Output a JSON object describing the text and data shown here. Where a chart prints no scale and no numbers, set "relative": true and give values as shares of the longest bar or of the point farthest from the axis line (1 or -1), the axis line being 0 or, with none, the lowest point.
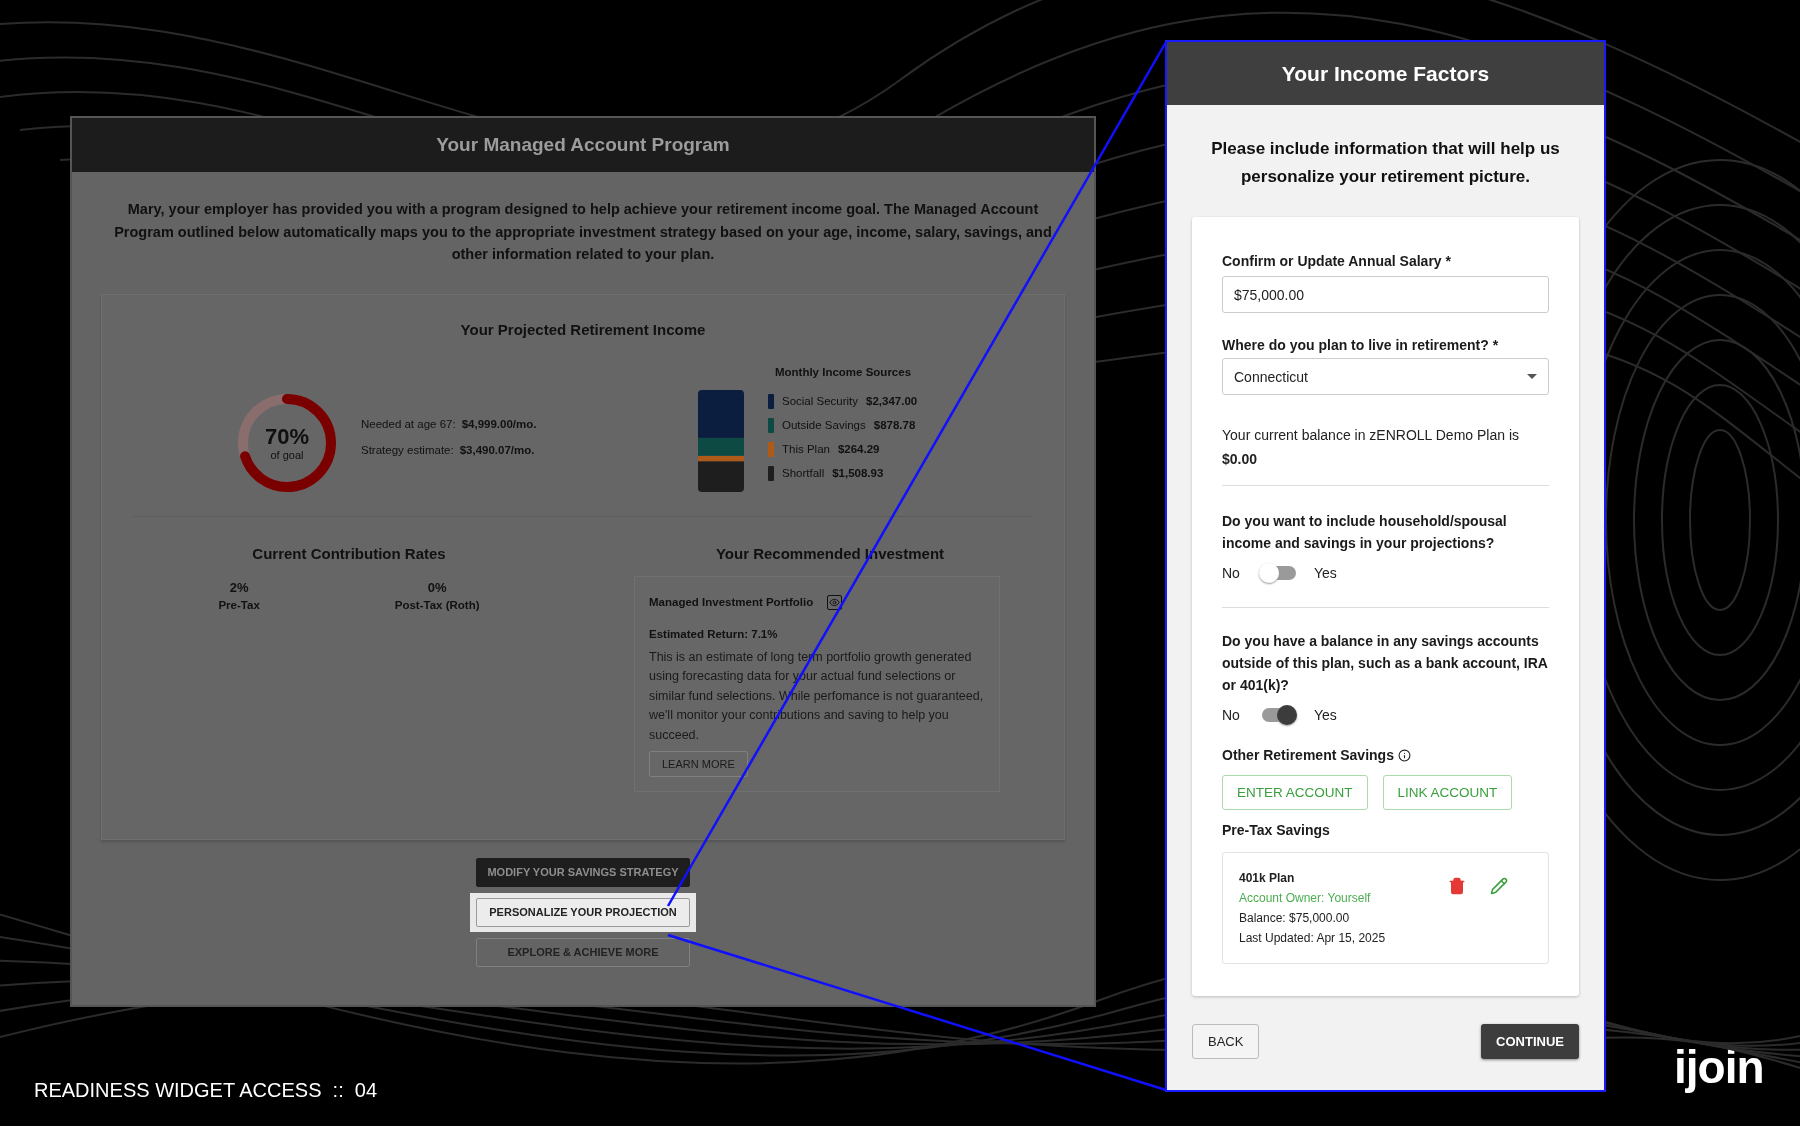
{
  "left_panel": {
    "title": "Your Managed Account Program",
    "intro": "Mary, your employer has provided you with a program designed to help achieve your retirement income goal. The Managed Account Program outlined below automatically maps you to the appropriate investment strategy based on your age, income, salary, savings, and other information related to your plan.",
    "projection": {
      "title": "Your Projected Retirement Income",
      "goal": {
        "percent": "70%",
        "caption": "of goal",
        "level": 0.7
      },
      "stats": [
        {
          "label": "Needed at age 67:",
          "value": "$4,999.00/mo."
        },
        {
          "label": "Strategy estimate:",
          "value": "$3,490.07/mo."
        }
      ],
      "chart_data": {
        "type": "bar",
        "stacked": true,
        "relative": true,
        "legend": "right",
        "title": "Monthly Income Sources",
        "series": [
          {
            "name": "Shortfall",
            "color": "#1e1e1e",
            "values": [
              0.3018
            ]
          },
          {
            "name": "This Plan",
            "color": "#b05a1a",
            "values": [
              0.0529
            ]
          },
          {
            "name": "Outside Savings",
            "color": "#0e4a44",
            "values": [
              0.1758
            ]
          },
          {
            "name": "Social Security",
            "color": "#0b1e3f",
            "values": [
              0.4695
            ]
          }
        ],
        "value_labels": [
          "$1,508.93",
          "$264.29",
          "$878.78",
          "$2,347.00"
        ]
      }
    },
    "contribution": {
      "title": "Current Contribution Rates",
      "rates": [
        {
          "value": "2%",
          "label": "Pre-Tax"
        },
        {
          "value": "0%",
          "label": "Post-Tax (Roth)"
        }
      ]
    },
    "recommendation": {
      "title": "Your Recommended Investment",
      "portfolio": "Managed Investment Portfolio",
      "estimate": "Estimated Return: 7.1%",
      "description": "This is an estimate of long term portfolio growth generated using forecasting data for your actual fund selections or similar fund selections. While perfomance is not guaranteed, we'll monitor your contributions and saving to help you succeed.",
      "button": "LEARN MORE"
    },
    "actions": [
      {
        "label": "MODIFY YOUR SAVINGS STRATEGY",
        "kind": "dark",
        "highlighted": false
      },
      {
        "label": "PERSONALIZE YOUR PROJECTION",
        "kind": "outline",
        "highlighted": true
      },
      {
        "label": "EXPLORE & ACHIEVE MORE",
        "kind": "outline",
        "highlighted": false
      }
    ]
  },
  "right_panel": {
    "title": "Your Income Factors",
    "intro": "Please include information that will help us personalize your retirement picture.",
    "salary": {
      "label": "Confirm or Update Annual Salary *",
      "value": "$75,000.00"
    },
    "residence": {
      "label": "Where do you plan to live in retirement? *",
      "value": "Connecticut"
    },
    "balance": "Your current balance in zENROLL Demo Plan is **$0.00**",
    "questions": [
      {
        "text": "Do you want to include household/spousal income and savings in your projections?",
        "no": "No",
        "yes": "Yes",
        "on": false
      },
      {
        "text": "Do you have a balance in any savings accounts outside of this plan, such as a bank account, IRA or 401(k)?",
        "no": "No",
        "yes": "Yes",
        "on": true
      }
    ],
    "other_savings": {
      "title": "Other Retirement Savings",
      "buttons": [
        "ENTER ACCOUNT",
        "LINK ACCOUNT"
      ],
      "section": "Pre-Tax Savings",
      "accounts": [
        {
          "name": "401k Plan",
          "owner": "Account Owner: Yourself",
          "balance": "Balance: $75,000.00",
          "updated": "Last Updated: Apr 15, 2025"
        }
      ]
    },
    "back": "BACK",
    "continue": "CONTINUE"
  },
  "footer": {
    "caption": "READINESS WIDGET ACCESS  ::  04",
    "logo": "ijoin"
  }
}
